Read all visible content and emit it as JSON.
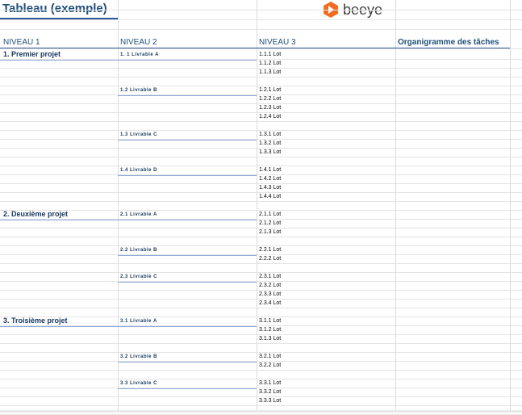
{
  "title": "Tableau (exemple)",
  "logo_text": "beeye",
  "headers": {
    "n1": "NIVEAU 1",
    "n2": "NIVEAU 2",
    "n3": "NIVEAU  3",
    "org": "Organigramme des tâches"
  },
  "projects": [
    {
      "label": "1. Premier projet",
      "deliverables": [
        {
          "label": "1. 1 Livrable A",
          "lots": [
            "1.1.1 Lot",
            "1.1.2 Lot",
            "1.1.3 Lot"
          ]
        },
        {
          "label": "1.2 Livrable B",
          "lots": [
            "1.2.1 Lot",
            "1.2.2 Lot",
            "1.2.3 Lot",
            "1.2.4 Lot"
          ]
        },
        {
          "label": "1.3 Livrable C",
          "lots": [
            "1.3.1 Lot",
            "1.3.2 Lot",
            "1.3.3 Lot"
          ]
        },
        {
          "label": "1.4 Livrable D",
          "lots": [
            "1.4.1 Lot",
            "1.4.2 Lot",
            "1.4.3 Lot",
            "1.4.4 Lot"
          ]
        }
      ]
    },
    {
      "label": "2. Deuxième projet",
      "deliverables": [
        {
          "label": "2.1 Livrable A",
          "lots": [
            "2.1.1 Lot",
            "2.1.2 Lot",
            "2.1.3 Lot"
          ]
        },
        {
          "label": "2.2 Livrable B",
          "lots": [
            "2.2.1 Lot",
            "2.2.2 Lot"
          ]
        },
        {
          "label": "2.3 Livrable C",
          "lots": [
            "2.3.1 Lot",
            "2.3.2 Lot",
            "2.3.3 Lot",
            "2.3.4 Lot"
          ]
        }
      ]
    },
    {
      "label": "3. Troisième projet",
      "deliverables": [
        {
          "label": "3.1 Livrable A",
          "lots": [
            "3.1.1 Lot",
            "3.1.2 Lot",
            "3.1.3 Lot"
          ]
        },
        {
          "label": "3.2 Livrable B",
          "lots": [
            "3.2.1 Lot",
            "3.2.2 Lot"
          ]
        },
        {
          "label": "3.3 Livrable C",
          "lots": [
            "3.3.1 Lot",
            "3.3.2 Lot",
            "3.3.3 Lot"
          ]
        }
      ]
    }
  ]
}
